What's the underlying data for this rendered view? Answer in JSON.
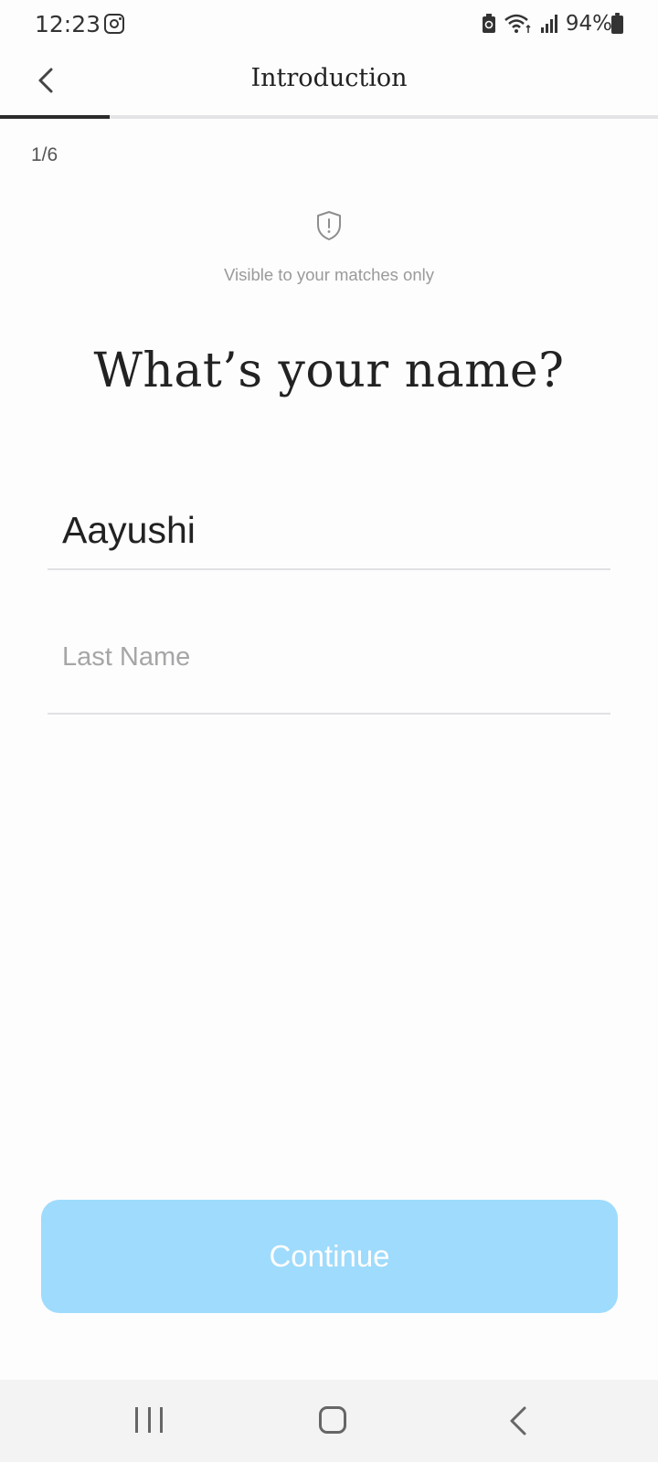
{
  "status_bar": {
    "time": "12:23",
    "battery_percent": "94%",
    "icons": [
      "instagram-icon",
      "battery-saver-icon",
      "wifi-icon",
      "signal-icon",
      "battery-icon"
    ]
  },
  "header": {
    "title": "Introduction",
    "back_icon": "chevron-left-icon",
    "progress_fraction": 0.1667
  },
  "step": {
    "counter": "1/6"
  },
  "visibility": {
    "icon": "shield-exclamation-icon",
    "note": "Visible to your matches only"
  },
  "question": {
    "title": "What’s your name?"
  },
  "form": {
    "first_name": {
      "value": "Aayushi",
      "placeholder": ""
    },
    "last_name": {
      "value": "",
      "placeholder": "Last Name"
    }
  },
  "continue_button": {
    "label": "Continue",
    "color": "#9fdbfc"
  },
  "nav_bar": {
    "icons": [
      "recents-icon",
      "home-icon",
      "back-icon"
    ]
  }
}
